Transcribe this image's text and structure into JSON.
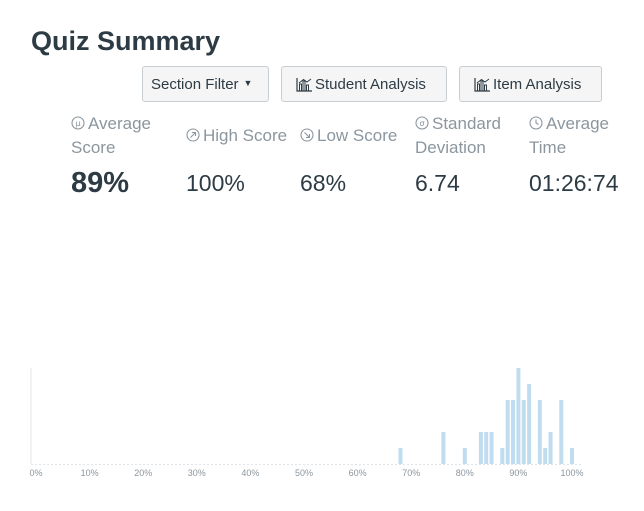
{
  "page": {
    "title": "Quiz Summary"
  },
  "toolbar": {
    "section_filter_label": "Section Filter",
    "student_analysis_label": "Student Analysis",
    "item_analysis_label": "Item Analysis"
  },
  "stats": {
    "average_score": {
      "label_line1": "Average",
      "label_line2": "Score",
      "value": "89%",
      "icon": "mu-icon"
    },
    "high_score": {
      "label": "High Score",
      "value": "100%",
      "icon": "arrow-up-right-icon"
    },
    "low_score": {
      "label": "Low Score",
      "value": "68%",
      "icon": "arrow-down-right-icon"
    },
    "std_dev": {
      "label_line1": "Standard",
      "label_line2": "Deviation",
      "value": "6.74",
      "icon": "sigma-icon"
    },
    "average_time": {
      "label_line1": "Average",
      "label_line2": "Time",
      "value": "01:26:74",
      "icon": "clock-icon"
    }
  },
  "colors": {
    "bar": "#c0dcef",
    "axis": "#dfe5ea",
    "text_muted": "#8b969e",
    "text_main": "#2d3b45"
  },
  "chart_data": {
    "type": "bar",
    "xlabel": "",
    "ylabel": "",
    "xlim": [
      0,
      100
    ],
    "ylim": [
      0,
      3
    ],
    "x_ticks": [
      "0%",
      "10%",
      "20%",
      "30%",
      "40%",
      "50%",
      "60%",
      "70%",
      "80%",
      "90%",
      "100%"
    ],
    "x": [
      68,
      76,
      80,
      83,
      84,
      85,
      87,
      88,
      89,
      90,
      91,
      92,
      94,
      95,
      96,
      98,
      100
    ],
    "values": [
      0.5,
      1,
      0.5,
      1,
      1,
      1,
      0.5,
      2,
      2,
      3,
      2,
      2.5,
      2,
      0.5,
      1,
      2,
      0.5
    ]
  }
}
